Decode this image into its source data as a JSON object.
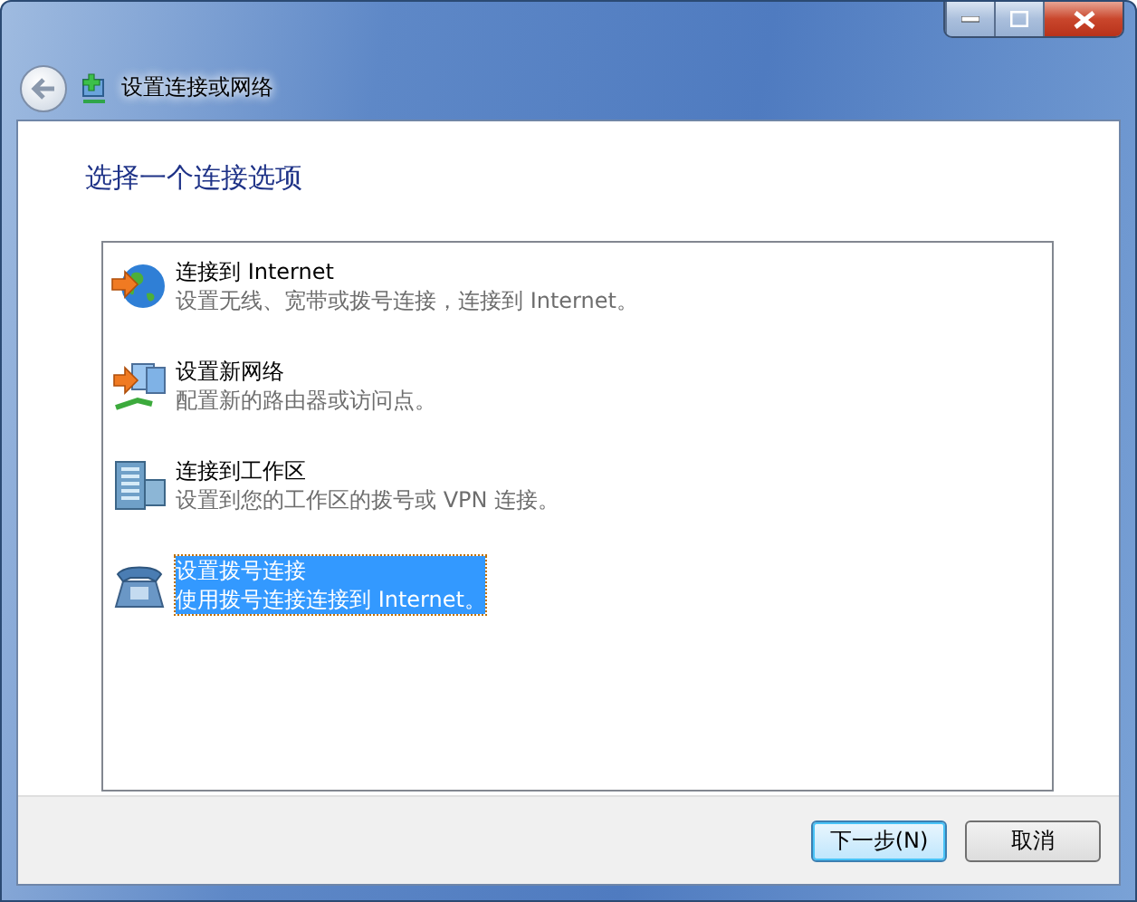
{
  "window": {
    "title": "设置连接或网络"
  },
  "heading": "选择一个连接选项",
  "options": [
    {
      "kind": "globe",
      "title": "连接到 Internet",
      "description": "设置无线、宽带或拨号连接，连接到 Internet。",
      "selected": false
    },
    {
      "kind": "network",
      "title": "设置新网络",
      "description": "配置新的路由器或访问点。",
      "selected": false
    },
    {
      "kind": "building",
      "title": "连接到工作区",
      "description": "设置到您的工作区的拨号或 VPN 连接。",
      "selected": false
    },
    {
      "kind": "phone",
      "title": "设置拨号连接",
      "description": "使用拨号连接连接到 Internet。",
      "selected": true
    }
  ],
  "buttons": [
    {
      "label": "下一步(N)",
      "default": true
    },
    {
      "label": "取消",
      "default": false
    }
  ]
}
